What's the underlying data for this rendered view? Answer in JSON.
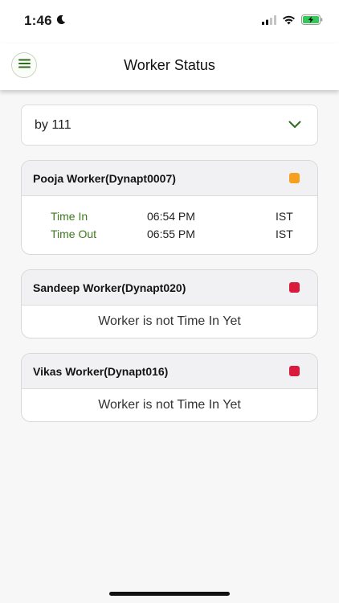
{
  "status_bar": {
    "time": "1:46",
    "icons": [
      "moon-icon",
      "cellular-signal-icon",
      "wifi-icon",
      "battery-charging-icon"
    ]
  },
  "header": {
    "title": "Worker Status",
    "menu_icon": "hamburger-menu-icon"
  },
  "filter": {
    "selected": "by 111",
    "icon": "chevron-down-icon"
  },
  "colors": {
    "accent_green": "#3e7a1e",
    "status_orange": "#f5a11f",
    "status_red": "#d91a3c"
  },
  "workers": [
    {
      "name": "Pooja Worker(Dynapt0007)",
      "status_color": "#f5a11f",
      "time_in_label": "Time In",
      "time_in": "06:54 PM",
      "time_in_zone": "IST",
      "time_out_label": "Time Out",
      "time_out": "06:55 PM",
      "time_out_zone": "IST"
    },
    {
      "name": "Sandeep Worker(Dynapt020)",
      "status_color": "#d91a3c",
      "message": "Worker is not Time In Yet"
    },
    {
      "name": "Vikas Worker(Dynapt016)",
      "status_color": "#d91a3c",
      "message": "Worker is not Time In Yet"
    }
  ]
}
